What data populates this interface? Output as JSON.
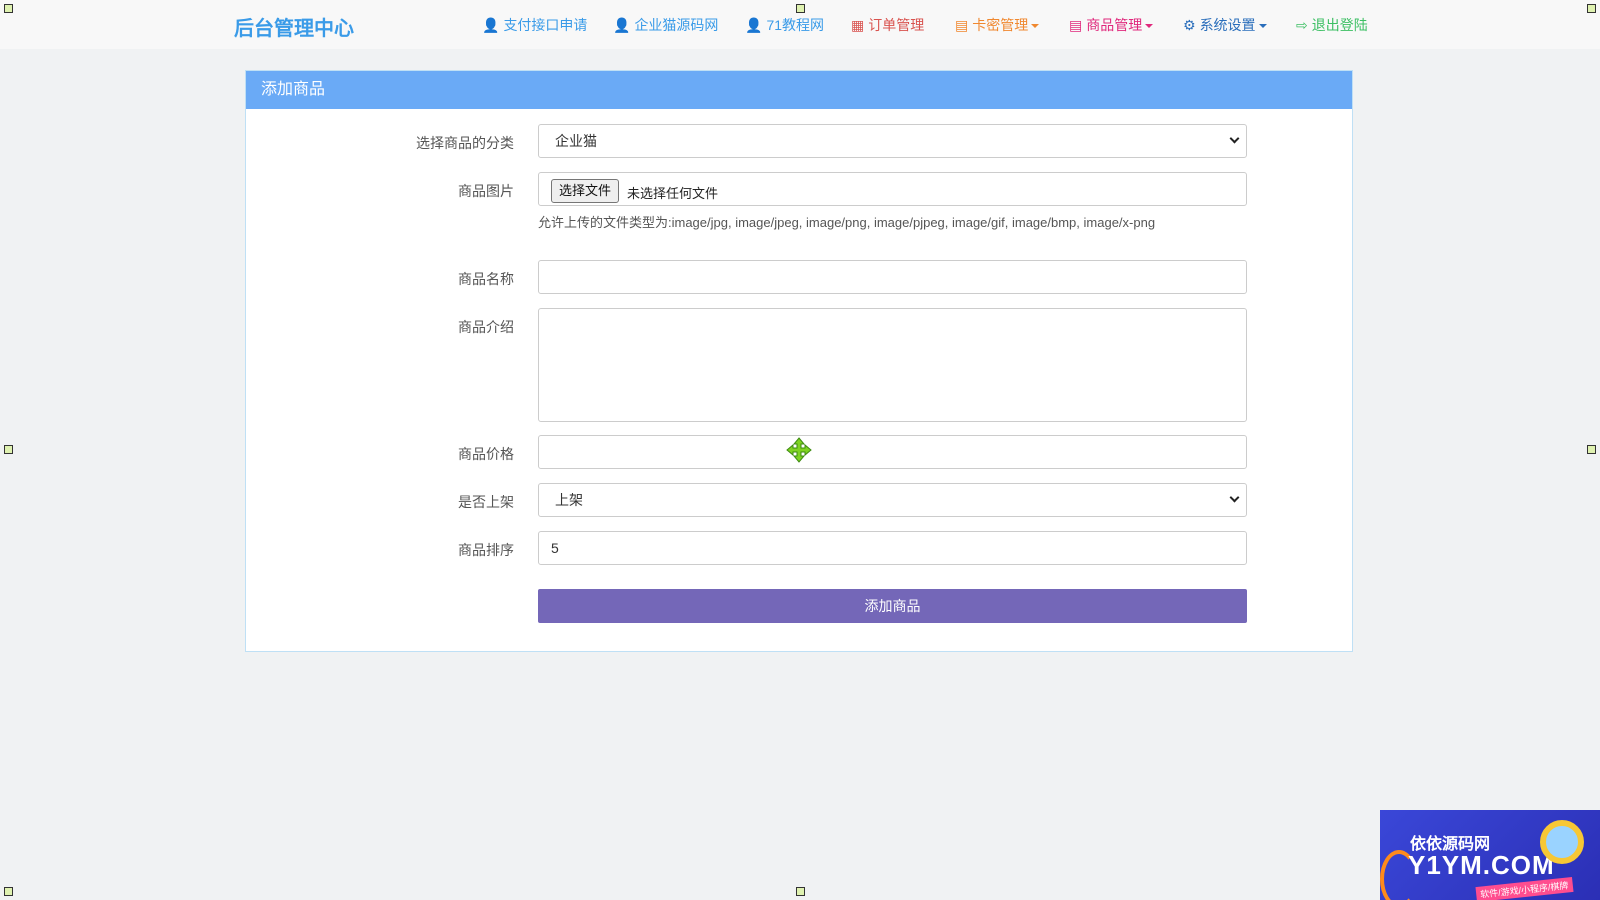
{
  "brand": "后台管理中心",
  "nav": [
    {
      "label": "支付接口申请",
      "icon": "user-icon",
      "glyph": "👤",
      "color": "#3a9be8"
    },
    {
      "label": "企业猫源码网",
      "icon": "user-icon",
      "glyph": "👤",
      "color": "#3a9be8"
    },
    {
      "label": "71教程网",
      "icon": "user-icon",
      "glyph": "👤",
      "color": "#3a9be8"
    },
    {
      "label": "订单管理",
      "icon": "calendar-icon",
      "glyph": "▦",
      "color": "#d9534f"
    },
    {
      "label": "卡密管理",
      "icon": "list-icon",
      "glyph": "▤",
      "color": "#f0882f"
    },
    {
      "label": "商品管理",
      "icon": "list-icon",
      "glyph": "▤",
      "color": "#e0287c"
    },
    {
      "label": "系统设置",
      "icon": "gear-icon",
      "glyph": "⚙",
      "color": "#2a6ebb"
    },
    {
      "label": "退出登陆",
      "icon": "logout-icon",
      "glyph": "⇨",
      "color": "#3cbf63"
    }
  ],
  "panel": {
    "title": "添加商品"
  },
  "form": {
    "category_label": "选择商品的分类",
    "category_value": "企业猫",
    "image_label": "商品图片",
    "file_button": "选择文件",
    "file_status": "未选择任何文件",
    "file_help": "允许上传的文件类型为:image/jpg, image/jpeg, image/png, image/pjpeg, image/gif, image/bmp, image/x-png",
    "name_label": "商品名称",
    "name_value": "",
    "desc_label": "商品介绍",
    "desc_value": "",
    "price_label": "商品价格",
    "price_value": "",
    "listed_label": "是否上架",
    "listed_value": "上架",
    "sort_label": "商品排序",
    "sort_value": "5",
    "submit_label": "添加商品"
  },
  "watermark": {
    "line1": "依依源码网",
    "line2": "Y1YM.COM",
    "line3": "软件/游戏/小程序/棋牌"
  }
}
